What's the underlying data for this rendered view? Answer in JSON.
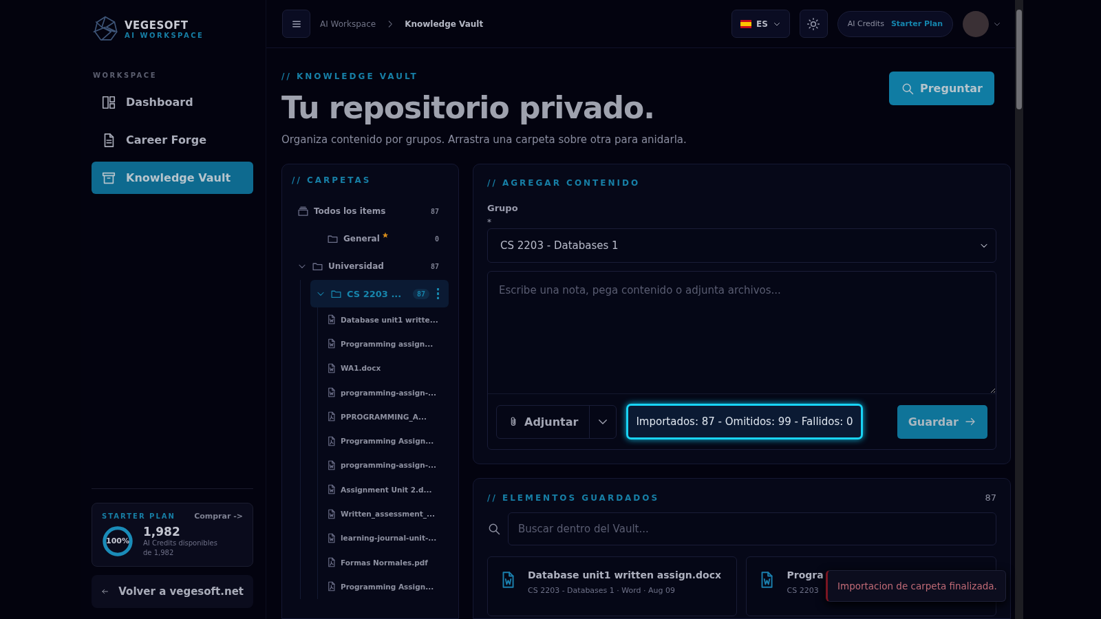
{
  "brand": {
    "name": "VEGESOFT",
    "tagline": "AI WORKSPACE"
  },
  "sidebar": {
    "section": "WORKSPACE",
    "items": [
      {
        "label": "Dashboard",
        "selected": false
      },
      {
        "label": "Career Forge",
        "selected": false
      },
      {
        "label": "Knowledge Vault",
        "selected": true
      }
    ]
  },
  "plan": {
    "title": "STARTER PLAN",
    "buy": "Comprar ->",
    "percent": "100%",
    "level": 1,
    "credits": "1,982",
    "caption": "AI Credits disponibles",
    "total": "de 1,982"
  },
  "back_link": "Volver a vegesoft.net",
  "topbar": {
    "breadcrumbs": [
      "AI Workspace",
      "Knowledge Vault"
    ],
    "language": "ES",
    "credits_label": "AI Credits",
    "plan": "Starter Plan"
  },
  "header": {
    "eyebrow": "// KNOWLEDGE VAULT",
    "title": "Tu repositorio privado.",
    "subtitle": "Organiza contenido por grupos. Arrastra una carpeta sobre otra para anidarla.",
    "ask_button": "Preguntar"
  },
  "folders": {
    "title": "// CARPETAS",
    "tree": [
      {
        "kind": "all",
        "label": "Todos los items",
        "count": "87",
        "selected": false
      },
      {
        "kind": "folder",
        "label": "General",
        "favorite": true,
        "count": "0",
        "selected": false
      },
      {
        "kind": "folder",
        "label": "Universidad",
        "favorite": false,
        "count": "87",
        "expanded": true,
        "selected": false,
        "children": [
          {
            "kind": "folder",
            "label": "CS 2203 ...",
            "favorite": false,
            "count": "87",
            "expanded": true,
            "selected": true,
            "children": [
              {
                "kind": "word",
                "label": "Database unit1 writte...",
                "selected": false
              },
              {
                "kind": "word",
                "label": "Programming assign...",
                "selected": false
              },
              {
                "kind": "word",
                "label": "WA1.docx",
                "selected": false
              },
              {
                "kind": "word",
                "label": "programming-assign-...",
                "selected": false
              },
              {
                "kind": "pdf",
                "label": "PPROGRAMMING_A...",
                "selected": false
              },
              {
                "kind": "pdf",
                "label": "Programming Assign...",
                "selected": false
              },
              {
                "kind": "word",
                "label": "programming-assign-...",
                "selected": false
              },
              {
                "kind": "word",
                "label": "Assignment Unit 2.d...",
                "selected": false
              },
              {
                "kind": "word",
                "label": "Written_assessment_...",
                "selected": false
              },
              {
                "kind": "word",
                "label": "learning-journal-unit-...",
                "selected": false
              },
              {
                "kind": "pdf",
                "label": "Formas Normales.pdf",
                "selected": false
              },
              {
                "kind": "pdf",
                "label": "Programming Assign...",
                "selected": false
              }
            ]
          }
        ]
      }
    ]
  },
  "add_content": {
    "title": "// AGREGAR CONTENIDO",
    "group_label": "Grupo",
    "required_mark": "*",
    "group_value": "CS 2203 - Databases 1",
    "note_placeholder": "Escribe una nota, pega contenido o adjunta archivos...",
    "attach_button": "Adjuntar",
    "import_status": "Importados: 87 - Omitidos: 99 - Fallidos: 0",
    "save_button": "Guardar"
  },
  "saved": {
    "title": "// ELEMENTOS GUARDADOS",
    "count": "87",
    "search_placeholder": "Buscar dentro del Vault...",
    "items": [
      {
        "kind": "word",
        "title": "Database unit1 written assign.docx",
        "meta": "CS 2203 - Databases 1 · Word · Aug 09"
      },
      {
        "kind": "word",
        "title": "Progra",
        "meta": "CS 2203"
      }
    ]
  },
  "toast": {
    "message": "Importacion de carpeta finalizada."
  }
}
